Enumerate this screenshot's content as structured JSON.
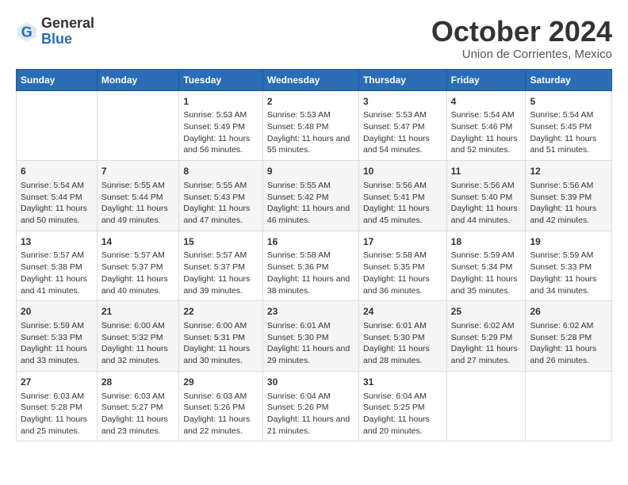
{
  "header": {
    "logo": {
      "general": "General",
      "blue": "Blue"
    },
    "title": "October 2024",
    "subtitle": "Union de Corrientes, Mexico"
  },
  "calendar": {
    "days_of_week": [
      "Sunday",
      "Monday",
      "Tuesday",
      "Wednesday",
      "Thursday",
      "Friday",
      "Saturday"
    ],
    "weeks": [
      [
        {
          "num": "",
          "info": ""
        },
        {
          "num": "",
          "info": ""
        },
        {
          "num": "1",
          "info": "Sunrise: 5:53 AM\nSunset: 5:49 PM\nDaylight: 11 hours and 56 minutes."
        },
        {
          "num": "2",
          "info": "Sunrise: 5:53 AM\nSunset: 5:48 PM\nDaylight: 11 hours and 55 minutes."
        },
        {
          "num": "3",
          "info": "Sunrise: 5:53 AM\nSunset: 5:47 PM\nDaylight: 11 hours and 54 minutes."
        },
        {
          "num": "4",
          "info": "Sunrise: 5:54 AM\nSunset: 5:46 PM\nDaylight: 11 hours and 52 minutes."
        },
        {
          "num": "5",
          "info": "Sunrise: 5:54 AM\nSunset: 5:45 PM\nDaylight: 11 hours and 51 minutes."
        }
      ],
      [
        {
          "num": "6",
          "info": "Sunrise: 5:54 AM\nSunset: 5:44 PM\nDaylight: 11 hours and 50 minutes."
        },
        {
          "num": "7",
          "info": "Sunrise: 5:55 AM\nSunset: 5:44 PM\nDaylight: 11 hours and 49 minutes."
        },
        {
          "num": "8",
          "info": "Sunrise: 5:55 AM\nSunset: 5:43 PM\nDaylight: 11 hours and 47 minutes."
        },
        {
          "num": "9",
          "info": "Sunrise: 5:55 AM\nSunset: 5:42 PM\nDaylight: 11 hours and 46 minutes."
        },
        {
          "num": "10",
          "info": "Sunrise: 5:56 AM\nSunset: 5:41 PM\nDaylight: 11 hours and 45 minutes."
        },
        {
          "num": "11",
          "info": "Sunrise: 5:56 AM\nSunset: 5:40 PM\nDaylight: 11 hours and 44 minutes."
        },
        {
          "num": "12",
          "info": "Sunrise: 5:56 AM\nSunset: 5:39 PM\nDaylight: 11 hours and 42 minutes."
        }
      ],
      [
        {
          "num": "13",
          "info": "Sunrise: 5:57 AM\nSunset: 5:38 PM\nDaylight: 11 hours and 41 minutes."
        },
        {
          "num": "14",
          "info": "Sunrise: 5:57 AM\nSunset: 5:37 PM\nDaylight: 11 hours and 40 minutes."
        },
        {
          "num": "15",
          "info": "Sunrise: 5:57 AM\nSunset: 5:37 PM\nDaylight: 11 hours and 39 minutes."
        },
        {
          "num": "16",
          "info": "Sunrise: 5:58 AM\nSunset: 5:36 PM\nDaylight: 11 hours and 38 minutes."
        },
        {
          "num": "17",
          "info": "Sunrise: 5:58 AM\nSunset: 5:35 PM\nDaylight: 11 hours and 36 minutes."
        },
        {
          "num": "18",
          "info": "Sunrise: 5:59 AM\nSunset: 5:34 PM\nDaylight: 11 hours and 35 minutes."
        },
        {
          "num": "19",
          "info": "Sunrise: 5:59 AM\nSunset: 5:33 PM\nDaylight: 11 hours and 34 minutes."
        }
      ],
      [
        {
          "num": "20",
          "info": "Sunrise: 5:59 AM\nSunset: 5:33 PM\nDaylight: 11 hours and 33 minutes."
        },
        {
          "num": "21",
          "info": "Sunrise: 6:00 AM\nSunset: 5:32 PM\nDaylight: 11 hours and 32 minutes."
        },
        {
          "num": "22",
          "info": "Sunrise: 6:00 AM\nSunset: 5:31 PM\nDaylight: 11 hours and 30 minutes."
        },
        {
          "num": "23",
          "info": "Sunrise: 6:01 AM\nSunset: 5:30 PM\nDaylight: 11 hours and 29 minutes."
        },
        {
          "num": "24",
          "info": "Sunrise: 6:01 AM\nSunset: 5:30 PM\nDaylight: 11 hours and 28 minutes."
        },
        {
          "num": "25",
          "info": "Sunrise: 6:02 AM\nSunset: 5:29 PM\nDaylight: 11 hours and 27 minutes."
        },
        {
          "num": "26",
          "info": "Sunrise: 6:02 AM\nSunset: 5:28 PM\nDaylight: 11 hours and 26 minutes."
        }
      ],
      [
        {
          "num": "27",
          "info": "Sunrise: 6:03 AM\nSunset: 5:28 PM\nDaylight: 11 hours and 25 minutes."
        },
        {
          "num": "28",
          "info": "Sunrise: 6:03 AM\nSunset: 5:27 PM\nDaylight: 11 hours and 23 minutes."
        },
        {
          "num": "29",
          "info": "Sunrise: 6:03 AM\nSunset: 5:26 PM\nDaylight: 11 hours and 22 minutes."
        },
        {
          "num": "30",
          "info": "Sunrise: 6:04 AM\nSunset: 5:26 PM\nDaylight: 11 hours and 21 minutes."
        },
        {
          "num": "31",
          "info": "Sunrise: 6:04 AM\nSunset: 5:25 PM\nDaylight: 11 hours and 20 minutes."
        },
        {
          "num": "",
          "info": ""
        },
        {
          "num": "",
          "info": ""
        }
      ]
    ]
  }
}
